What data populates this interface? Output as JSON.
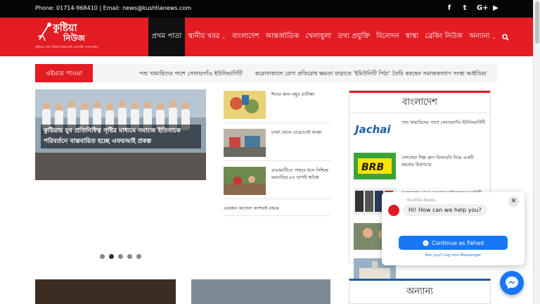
{
  "topbar": {
    "contact": "Phone: 01714-968410 | Email: news@kushtianews.com",
    "social": [
      "facebook-icon",
      "twitter-icon",
      "google-plus-icon",
      "youtube-icon"
    ],
    "social_glyphs": [
      "f",
      "t",
      "G+",
      "▶"
    ]
  },
  "logo": {
    "name1": "কুষ্টিয়া",
    "name2": "নিউজ",
    "tagline": "কুষ্টিয়ার জেলা ভিত্তিক নির্ভরযোগ্য অনলাইন সংবাদমাধ্যম"
  },
  "nav": {
    "items": [
      {
        "label": "প্রথম পাতা",
        "active": true
      },
      {
        "label": "স্থানীয় খবর",
        "dropdown": true
      },
      {
        "label": "বাংলাদেশ"
      },
      {
        "label": "আন্তর্জাতিক"
      },
      {
        "label": "খেলাধুলা"
      },
      {
        "label": "তথ্য প্রযুক্তি"
      },
      {
        "label": "বিনোদন"
      },
      {
        "label": "স্বাস্থ্য"
      },
      {
        "label": "ব্রেকিং নিউজ"
      },
      {
        "label": "অন্যান্য",
        "dropdown": true
      }
    ]
  },
  "breaking": {
    "label": "এইমাত্র পাওয়া",
    "items": [
      "পশু খামারিদের পাশে সোনারগাঁও ইউনিভার্সিটি",
      "করোনাকালে রোগ প্রতিরোধ ক্ষমতা বাড়াতে ‘ইমিউনিটি পিঠা’ তৈরি করছেন সমাজকল্যাণ সংস্থা আইডিয়া"
    ]
  },
  "slider": {
    "title": "কুষ্টিয়ায় যুব প্রতিনিধিত্ব সৃষ্টির মাধ্যমে সমাজে ইতিবাচক পরিবর্তনে বাস্তবায়িত হচ্ছে এফরআই প্রকল্প",
    "dots": 5,
    "active_dot": 1
  },
  "news_list": [
    {
      "text": "ঈদের জন্য মধুর প্রতীক্ষা"
    },
    {
      "text": "ঢাকা থেকে বেরোতেই আক্কা"
    },
    {
      "text": "রাঙামাটিতে পাহাড় ধসে নিশ্চিহ্ন ঘরবাড়ির ৯৫ ভাগই অবৈধ"
    }
  ],
  "news_plain": "একজন আদেনা ফ্যাশনই নায়ক",
  "panel": {
    "heading": "বাংলাদেশ",
    "rows": [
      {
        "logo": "Jachai",
        "text": "পশু খামারিদের পাশে সোনারগাঁও ইউনিভার্সিটি"
      },
      {
        "logo": "BRB",
        "text": "দেশসেরা শিল্প গ্রুপ বিআরবি নিয়ে একটি মহলের মিথ্যাচার"
      },
      {
        "logo": "",
        "text": "অগ্রযাত্রায় মানব কল্যাণ ফাউন্ডেশনের কমিটি গঠন"
      }
    ]
  },
  "panel2": {
    "heading": "অন্যান্য"
  },
  "chat": {
    "page_name": "Kushtia News",
    "greeting": "Hi! How can we help you?",
    "continue_label": "Continue as Fahad",
    "not_you": "Not you? Log into Messenger"
  }
}
